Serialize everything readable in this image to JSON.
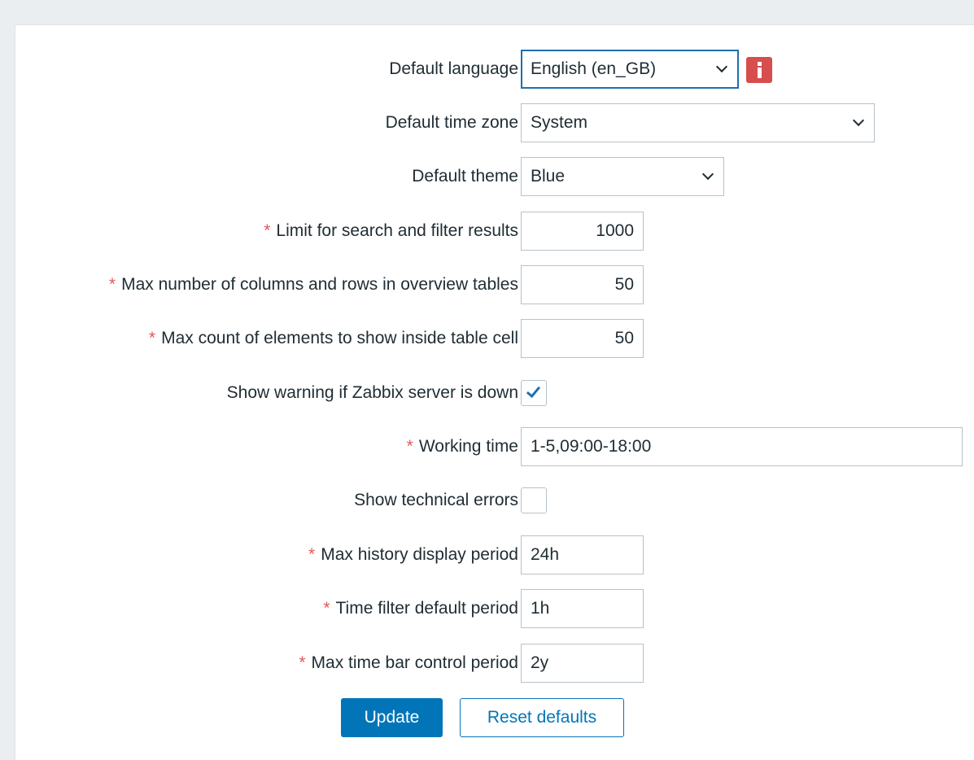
{
  "form": {
    "default_language": {
      "label": "Default language",
      "value": "English (en_GB)"
    },
    "default_timezone": {
      "label": "Default time zone",
      "value": "System"
    },
    "default_theme": {
      "label": "Default theme",
      "value": "Blue"
    },
    "search_limit": {
      "label": "Limit for search and filter results",
      "value": "1000",
      "required": true
    },
    "max_overview": {
      "label": "Max number of columns and rows in overview tables",
      "value": "50",
      "required": true
    },
    "max_in_table": {
      "label": "Max count of elements to show inside table cell",
      "value": "50",
      "required": true
    },
    "server_check": {
      "label": "Show warning if Zabbix server is down",
      "checked": true
    },
    "work_period": {
      "label": "Working time",
      "value": "1-5,09:00-18:00",
      "required": true
    },
    "show_tech_errors": {
      "label": "Show technical errors",
      "checked": false
    },
    "history_period": {
      "label": "Max history display period",
      "value": "24h",
      "required": true
    },
    "period_default": {
      "label": "Time filter default period",
      "value": "1h",
      "required": true
    },
    "max_period": {
      "label": "Max time bar control period",
      "value": "2y",
      "required": true
    },
    "required_marker": "*",
    "info_icon": "info-icon"
  },
  "buttons": {
    "update": "Update",
    "reset": "Reset defaults"
  },
  "colors": {
    "accent": "#0275b8",
    "required": "#e45959",
    "info_badge": "#d64e4e",
    "focus_border": "#1f6fb0"
  }
}
